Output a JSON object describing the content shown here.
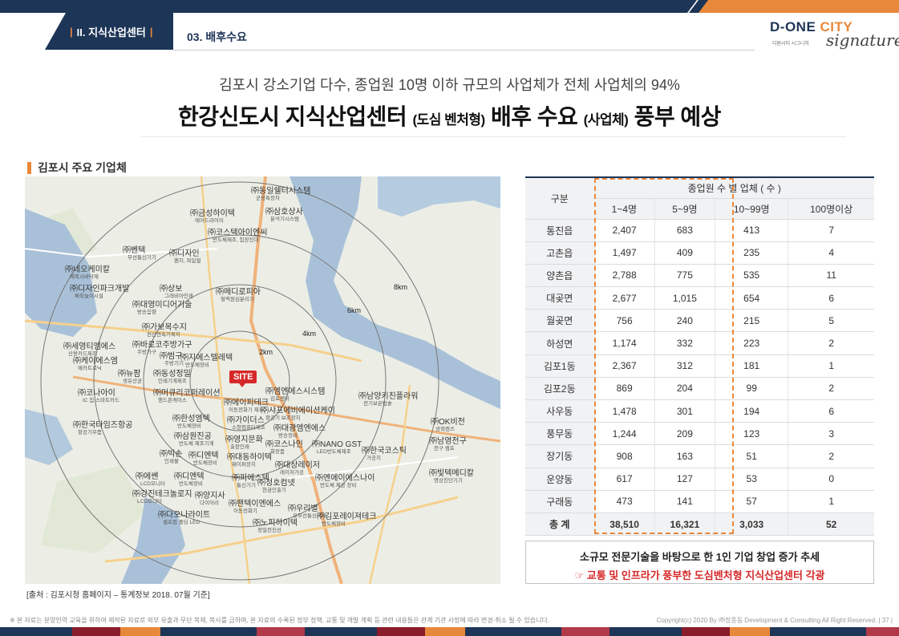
{
  "header": {
    "section": "II. 지식산업센터",
    "subtitle": "03. 배후수요",
    "logo_text": "D-ONE",
    "logo_city": "CITY",
    "logo_small": "디원시티 시그니처",
    "logo_signature": "signature"
  },
  "headline": {
    "lead": "김포시 강소기업 다수,  종업원 10명 이하 규모의 사업체가 전체 사업체의 94%",
    "main_a": "한강신도시 지식산업센터",
    "main_b": "(도심 벤처형)",
    "main_c": "배후 수요",
    "main_d": "(사업체)",
    "main_e": "풍부 예상"
  },
  "map_section": {
    "label": "김포시 주요 기업체",
    "site": "SITE",
    "rings": [
      "2km",
      "4km",
      "6km",
      "8km"
    ],
    "companies": [
      {
        "name": "㈜동일쉘터시스템",
        "sub": "군용특장차"
      },
      {
        "name": "㈜금성하이텍",
        "sub": "에어드라이어"
      },
      {
        "name": "㈜삼호상사",
        "sub": "분석기시스템"
      },
      {
        "name": "㈜코스텍아이엔씨",
        "sub": "반도체제조, 칩장진대"
      },
      {
        "name": "㈜벤텍",
        "sub": "무선통신기기"
      },
      {
        "name": "㈜디자인",
        "sub": "팬지, 파일럴"
      },
      {
        "name": "㈜네오케미칼",
        "sub": "에폭시바닥재"
      },
      {
        "name": "㈜디자인파크개발",
        "sub": "체육놀이시설"
      },
      {
        "name": "㈜상보",
        "sub": "그래비아인쇄"
      },
      {
        "name": "㈜메디로피아",
        "sub": "혈액원심분리기"
      },
      {
        "name": "㈜대영미디어기술",
        "sub": "방송음향"
      },
      {
        "name": "㈜가보목수지",
        "sub": "전산연속기록지"
      },
      {
        "name": "㈜바로코주방가구",
        "sub": "주방가구"
      },
      {
        "name": "㈜세영티엠에스",
        "sub": "산용카드제조"
      },
      {
        "name": "㈜범구",
        "sub": "주방기기"
      },
      {
        "name": "㈜지에스텔레텍",
        "sub": "반도체장비"
      },
      {
        "name": "㈜케이에스엠",
        "sub": "메카트로닉"
      },
      {
        "name": "㈜뉴팜",
        "sub": "생유산균"
      },
      {
        "name": "㈜동성정밀",
        "sub": "인쇄기계제조"
      },
      {
        "name": "㈜코나아이",
        "sub": "IC 칩 스마트카드"
      },
      {
        "name": "㈜머큐리코퍼레이션",
        "sub": "핸드폰케이스"
      },
      {
        "name": "㈜엠엔에스시스템",
        "sub": "김포센터"
      },
      {
        "name": "㈜에이피테크",
        "sub": "이동전화기 제조"
      },
      {
        "name": "㈜샤프에비에이션케이",
        "sub": "항공기 보조장치"
      },
      {
        "name": "㈜남양키친플라워",
        "sub": "전기보온밥솥"
      },
      {
        "name": "㈜한국타임즈항공",
        "sub": "항공기부품"
      },
      {
        "name": "㈜한성엠텍",
        "sub": "반도체장비"
      },
      {
        "name": "㈜가이더스",
        "sub": "소형컴퓨터제조"
      },
      {
        "name": "㈜대광엠엔에스",
        "sub": "방송장비"
      },
      {
        "name": "㈜OK비전",
        "sub": "광학렌즈"
      },
      {
        "name": "㈜삼원진공",
        "sub": "반도체 제조기계"
      },
      {
        "name": "㈜영지문화",
        "sub": "출판인쇄"
      },
      {
        "name": "㈜코스나인",
        "sub": "화장품"
      },
      {
        "name": "㈜NANO GST",
        "sub": "LED반도체제조"
      },
      {
        "name": "㈜남영전구",
        "sub": "전구 램프"
      },
      {
        "name": "㈜빅손",
        "sub": "인쇄물"
      },
      {
        "name": "㈜디엔텍",
        "sub": "반도체장비"
      },
      {
        "name": "㈜대동하이텍",
        "sub": "웨이퍼장치"
      },
      {
        "name": "㈜한국코스틱",
        "sub": "가공지"
      },
      {
        "name": "㈜대상레이저",
        "sub": "레이저가공"
      },
      {
        "name": "㈜에쎈",
        "sub": "LCD모니터"
      },
      {
        "name": "㈜디엔텍",
        "sub": "반도체장비"
      },
      {
        "name": "㈜피에스텍",
        "sub": "통신기기"
      },
      {
        "name": "㈜엔에이에스나이",
        "sub": "반도체 제공 장비"
      },
      {
        "name": "㈜빛텍메디칼",
        "sub": "명상진단기기"
      },
      {
        "name": "㈜강진테크놀로지",
        "sub": "LCD모니터"
      },
      {
        "name": "㈜청호컴넷",
        "sub": "현금인출기"
      },
      {
        "name": "㈜양지사",
        "sub": "다이어리"
      },
      {
        "name": "㈜팬텍이엔에스",
        "sub": "이동전화기"
      },
      {
        "name": "㈜우리별",
        "sub": "유무선통신기기"
      },
      {
        "name": "㈜다오나라이트",
        "sub": "셀프컴 폴딩 LED"
      },
      {
        "name": "㈜노피하이텍",
        "sub": "정밀전진선"
      },
      {
        "name": "㈜김포레이져테크",
        "sub": "반도체장비"
      }
    ]
  },
  "source": "[출처 : 김포시청 홈페이지 – 통계정보 2018. 07월 기준]",
  "table": {
    "col_region": "구분",
    "col_group": "종업원 수 별 업체 ( 수 )",
    "columns": [
      "1~4명",
      "5~9명",
      "10~99명",
      "100명이상"
    ],
    "rows": [
      {
        "region": "통진읍",
        "v": [
          "2,407",
          "683",
          "413",
          "7"
        ]
      },
      {
        "region": "고촌읍",
        "v": [
          "1,497",
          "409",
          "235",
          "4"
        ]
      },
      {
        "region": "양촌읍",
        "v": [
          "2,788",
          "775",
          "535",
          "11"
        ]
      },
      {
        "region": "대곶면",
        "v": [
          "2,677",
          "1,015",
          "654",
          "6"
        ]
      },
      {
        "region": "월곶면",
        "v": [
          "756",
          "240",
          "215",
          "5"
        ]
      },
      {
        "region": "하성면",
        "v": [
          "1,174",
          "332",
          "223",
          "2"
        ]
      },
      {
        "region": "김포1동",
        "v": [
          "2,367",
          "312",
          "181",
          "1"
        ]
      },
      {
        "region": "김포2동",
        "v": [
          "869",
          "204",
          "99",
          "2"
        ]
      },
      {
        "region": "사우동",
        "v": [
          "1,478",
          "301",
          "194",
          "6"
        ]
      },
      {
        "region": "풍무동",
        "v": [
          "1,244",
          "209",
          "123",
          "3"
        ]
      },
      {
        "region": "장기동",
        "v": [
          "908",
          "163",
          "51",
          "2"
        ]
      },
      {
        "region": "운양동",
        "v": [
          "617",
          "127",
          "53",
          "0"
        ]
      },
      {
        "region": "구래동",
        "v": [
          "473",
          "141",
          "57",
          "1"
        ]
      }
    ],
    "total": {
      "region": "총 계",
      "v": [
        "38,510",
        "16,321",
        "3,033",
        "52"
      ]
    }
  },
  "callout": {
    "line1": "소규모 전문기술을 바탕으로 한 1인 기업 창업 증가 추세",
    "line2": "☞ 교통 및 인프라가 풍부한 도심벤처형 지식산업센터 각광"
  },
  "footer": {
    "note": "※ 본 자료는 분양인력 교육을 위하여 제작된 자료로 외부 유출과 무단 복제, 복사를 금하며, 본 자료의 수록된 정부 정책, 교통 및 개발 계획 등 관련 내용들은 관계 기관 사정에 따라 변경·취소 될 수 있습니다.",
    "copyright": "Copyright(c) 2020 By ㈜정종동 Development & Consulting All Right Reserved. | 37 |"
  }
}
